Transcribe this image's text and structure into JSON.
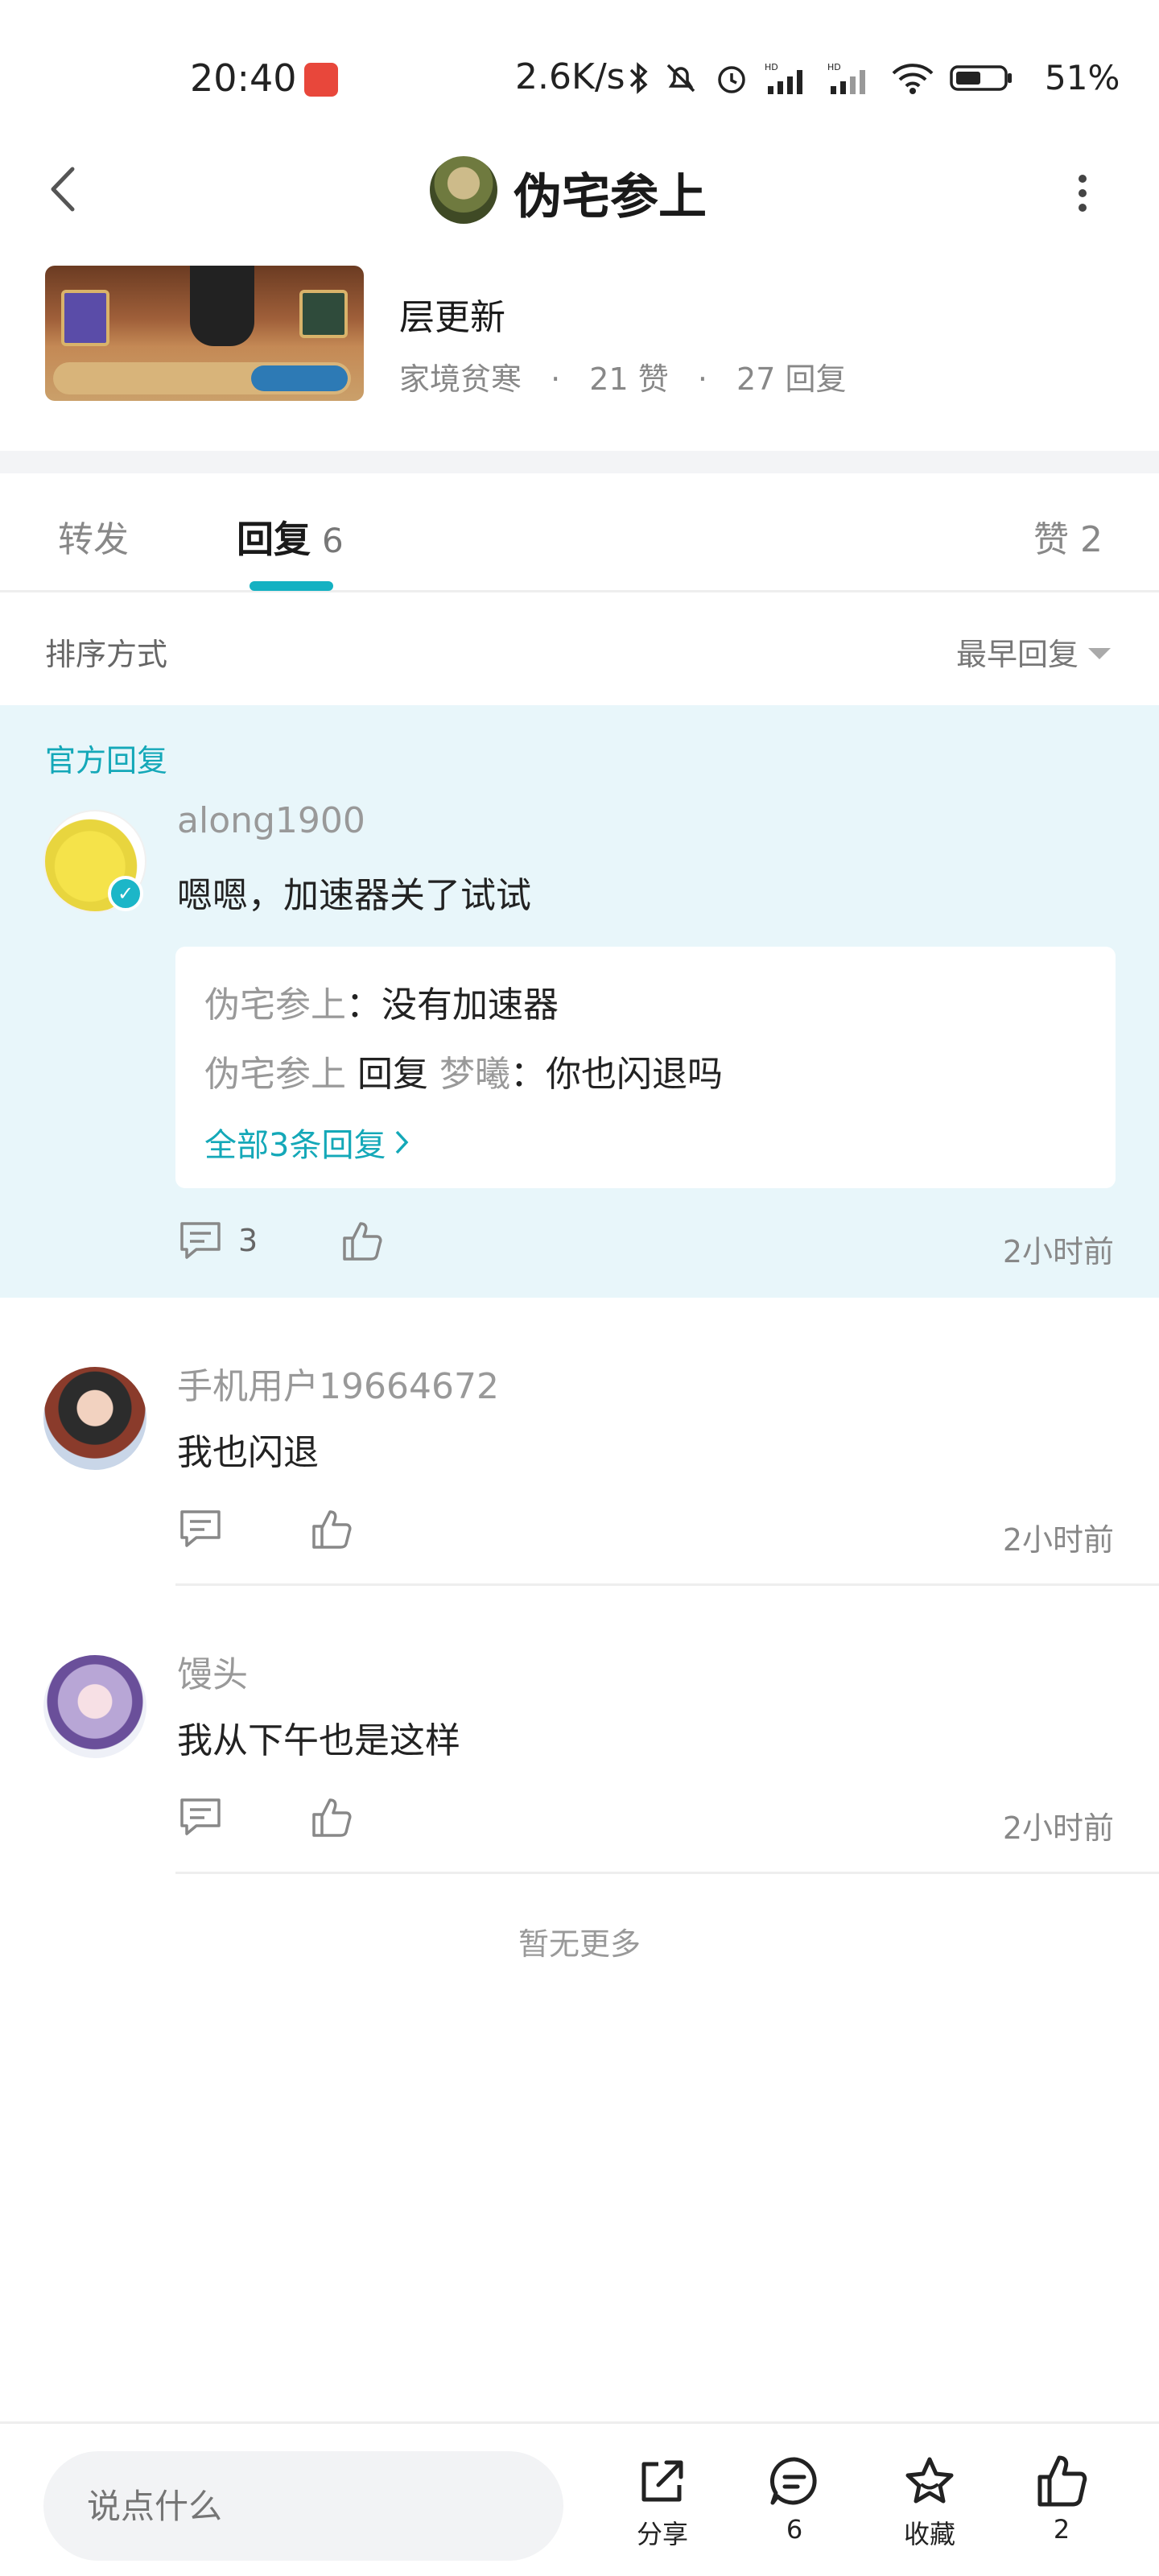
{
  "status_bar": {
    "time": "20:40",
    "weilink_badge": "WeiLink",
    "speed": "2.6K/s",
    "battery": "51%"
  },
  "header": {
    "title": "伪宅参上"
  },
  "post": {
    "title": "层更新",
    "author": "家境贫寒",
    "likes": "21 赞",
    "replies": "27 回复",
    "sep": "·"
  },
  "tabs": {
    "repost": "转发",
    "reply": "回复",
    "reply_count": "6",
    "like": "赞 2"
  },
  "sort": {
    "label": "排序方式",
    "value": "最早回复"
  },
  "official": {
    "label": "官方回复",
    "username": "along1900",
    "content": "嗯嗯，加速器关了试试",
    "sub_replies": [
      {
        "name": "伪宅参上",
        "text": "：没有加速器"
      },
      {
        "name": "伪宅参上",
        "mid": " 回复 ",
        "target": "梦曦",
        "text": "：你也闪退吗"
      }
    ],
    "view_all": "全部3条回复",
    "comment_count": "3",
    "time": "2小时前"
  },
  "replies": [
    {
      "username": "手机用户19664672",
      "content": "我也闪退",
      "time": "2小时前"
    },
    {
      "username": "馒头",
      "content": "我从下午也是这样",
      "time": "2小时前"
    }
  ],
  "footer_text": "暂无更多",
  "bottom_bar": {
    "input_placeholder": "说点什么",
    "share": "分享",
    "comments": "6",
    "favorite": "收藏",
    "likes": "2"
  },
  "colors": {
    "accent": "#14b1c2",
    "official_bg": "#e8f6fa"
  }
}
